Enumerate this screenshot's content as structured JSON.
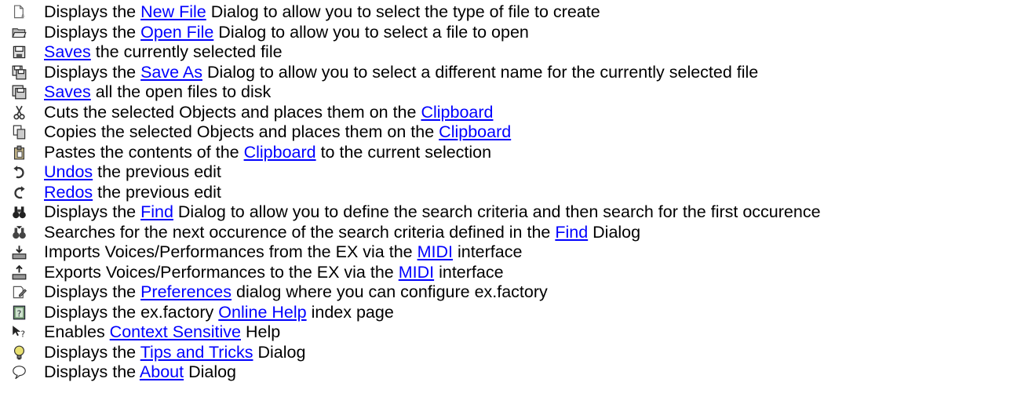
{
  "rows": [
    {
      "icon": "new-file-icon",
      "parts": [
        {
          "t": "Displays the "
        },
        {
          "t": "New File",
          "link": true
        },
        {
          "t": " Dialog to allow you to select the type of file to create"
        }
      ]
    },
    {
      "icon": "open-folder-icon",
      "parts": [
        {
          "t": "Displays the "
        },
        {
          "t": "Open File",
          "link": true
        },
        {
          "t": " Dialog to allow you to select a file to open"
        }
      ]
    },
    {
      "icon": "save-icon",
      "parts": [
        {
          "t": "Saves",
          "link": true
        },
        {
          "t": " the currently selected file"
        }
      ]
    },
    {
      "icon": "save-as-icon",
      "parts": [
        {
          "t": "Displays the "
        },
        {
          "t": "Save As",
          "link": true
        },
        {
          "t": " Dialog to allow you to select a different name for the currently selected file"
        }
      ]
    },
    {
      "icon": "save-all-icon",
      "parts": [
        {
          "t": "Saves",
          "link": true
        },
        {
          "t": " all the open files to disk"
        }
      ]
    },
    {
      "icon": "cut-icon",
      "parts": [
        {
          "t": "Cuts the selected Objects and places them on the "
        },
        {
          "t": "Clipboard",
          "link": true
        }
      ]
    },
    {
      "icon": "copy-icon",
      "parts": [
        {
          "t": "Copies the selected Objects and places them on the "
        },
        {
          "t": "Clipboard",
          "link": true
        }
      ]
    },
    {
      "icon": "paste-icon",
      "parts": [
        {
          "t": "Pastes the contents of the "
        },
        {
          "t": "Clipboard",
          "link": true
        },
        {
          "t": " to the current selection"
        }
      ]
    },
    {
      "icon": "undo-icon",
      "parts": [
        {
          "t": "Undos",
          "link": true
        },
        {
          "t": " the previous edit"
        }
      ]
    },
    {
      "icon": "redo-icon",
      "parts": [
        {
          "t": "Redos",
          "link": true
        },
        {
          "t": " the previous edit"
        }
      ]
    },
    {
      "icon": "find-binoculars-icon",
      "parts": [
        {
          "t": "Displays the "
        },
        {
          "t": "Find",
          "link": true
        },
        {
          "t": " Dialog to allow you to define the search criteria and then search for the first occurence"
        }
      ]
    },
    {
      "icon": "find-next-icon",
      "parts": [
        {
          "t": "Searches for the next occurence of the search criteria defined in the "
        },
        {
          "t": "Find",
          "link": true
        },
        {
          "t": " Dialog"
        }
      ]
    },
    {
      "icon": "import-icon",
      "parts": [
        {
          "t": "Imports Voices/Performances from the EX via the "
        },
        {
          "t": "MIDI",
          "link": true
        },
        {
          "t": " interface"
        }
      ]
    },
    {
      "icon": "export-icon",
      "parts": [
        {
          "t": "Exports Voices/Performances to the EX via the "
        },
        {
          "t": "MIDI",
          "link": true
        },
        {
          "t": " interface"
        }
      ]
    },
    {
      "icon": "preferences-icon",
      "parts": [
        {
          "t": "Displays the "
        },
        {
          "t": "Preferences",
          "link": true
        },
        {
          "t": " dialog where you can configure ex.factory"
        }
      ]
    },
    {
      "icon": "help-book-icon",
      "parts": [
        {
          "t": "Displays the ex.factory "
        },
        {
          "t": "Online Help",
          "link": true
        },
        {
          "t": " index page"
        }
      ]
    },
    {
      "icon": "context-help-icon",
      "parts": [
        {
          "t": "Enables "
        },
        {
          "t": "Context Sensitive",
          "link": true
        },
        {
          "t": " Help"
        }
      ]
    },
    {
      "icon": "lightbulb-icon",
      "parts": [
        {
          "t": "Displays the "
        },
        {
          "t": "Tips and Tricks",
          "link": true
        },
        {
          "t": " Dialog"
        }
      ]
    },
    {
      "icon": "about-balloon-icon",
      "parts": [
        {
          "t": "Displays the "
        },
        {
          "t": "About",
          "link": true
        },
        {
          "t": " Dialog"
        }
      ]
    }
  ]
}
